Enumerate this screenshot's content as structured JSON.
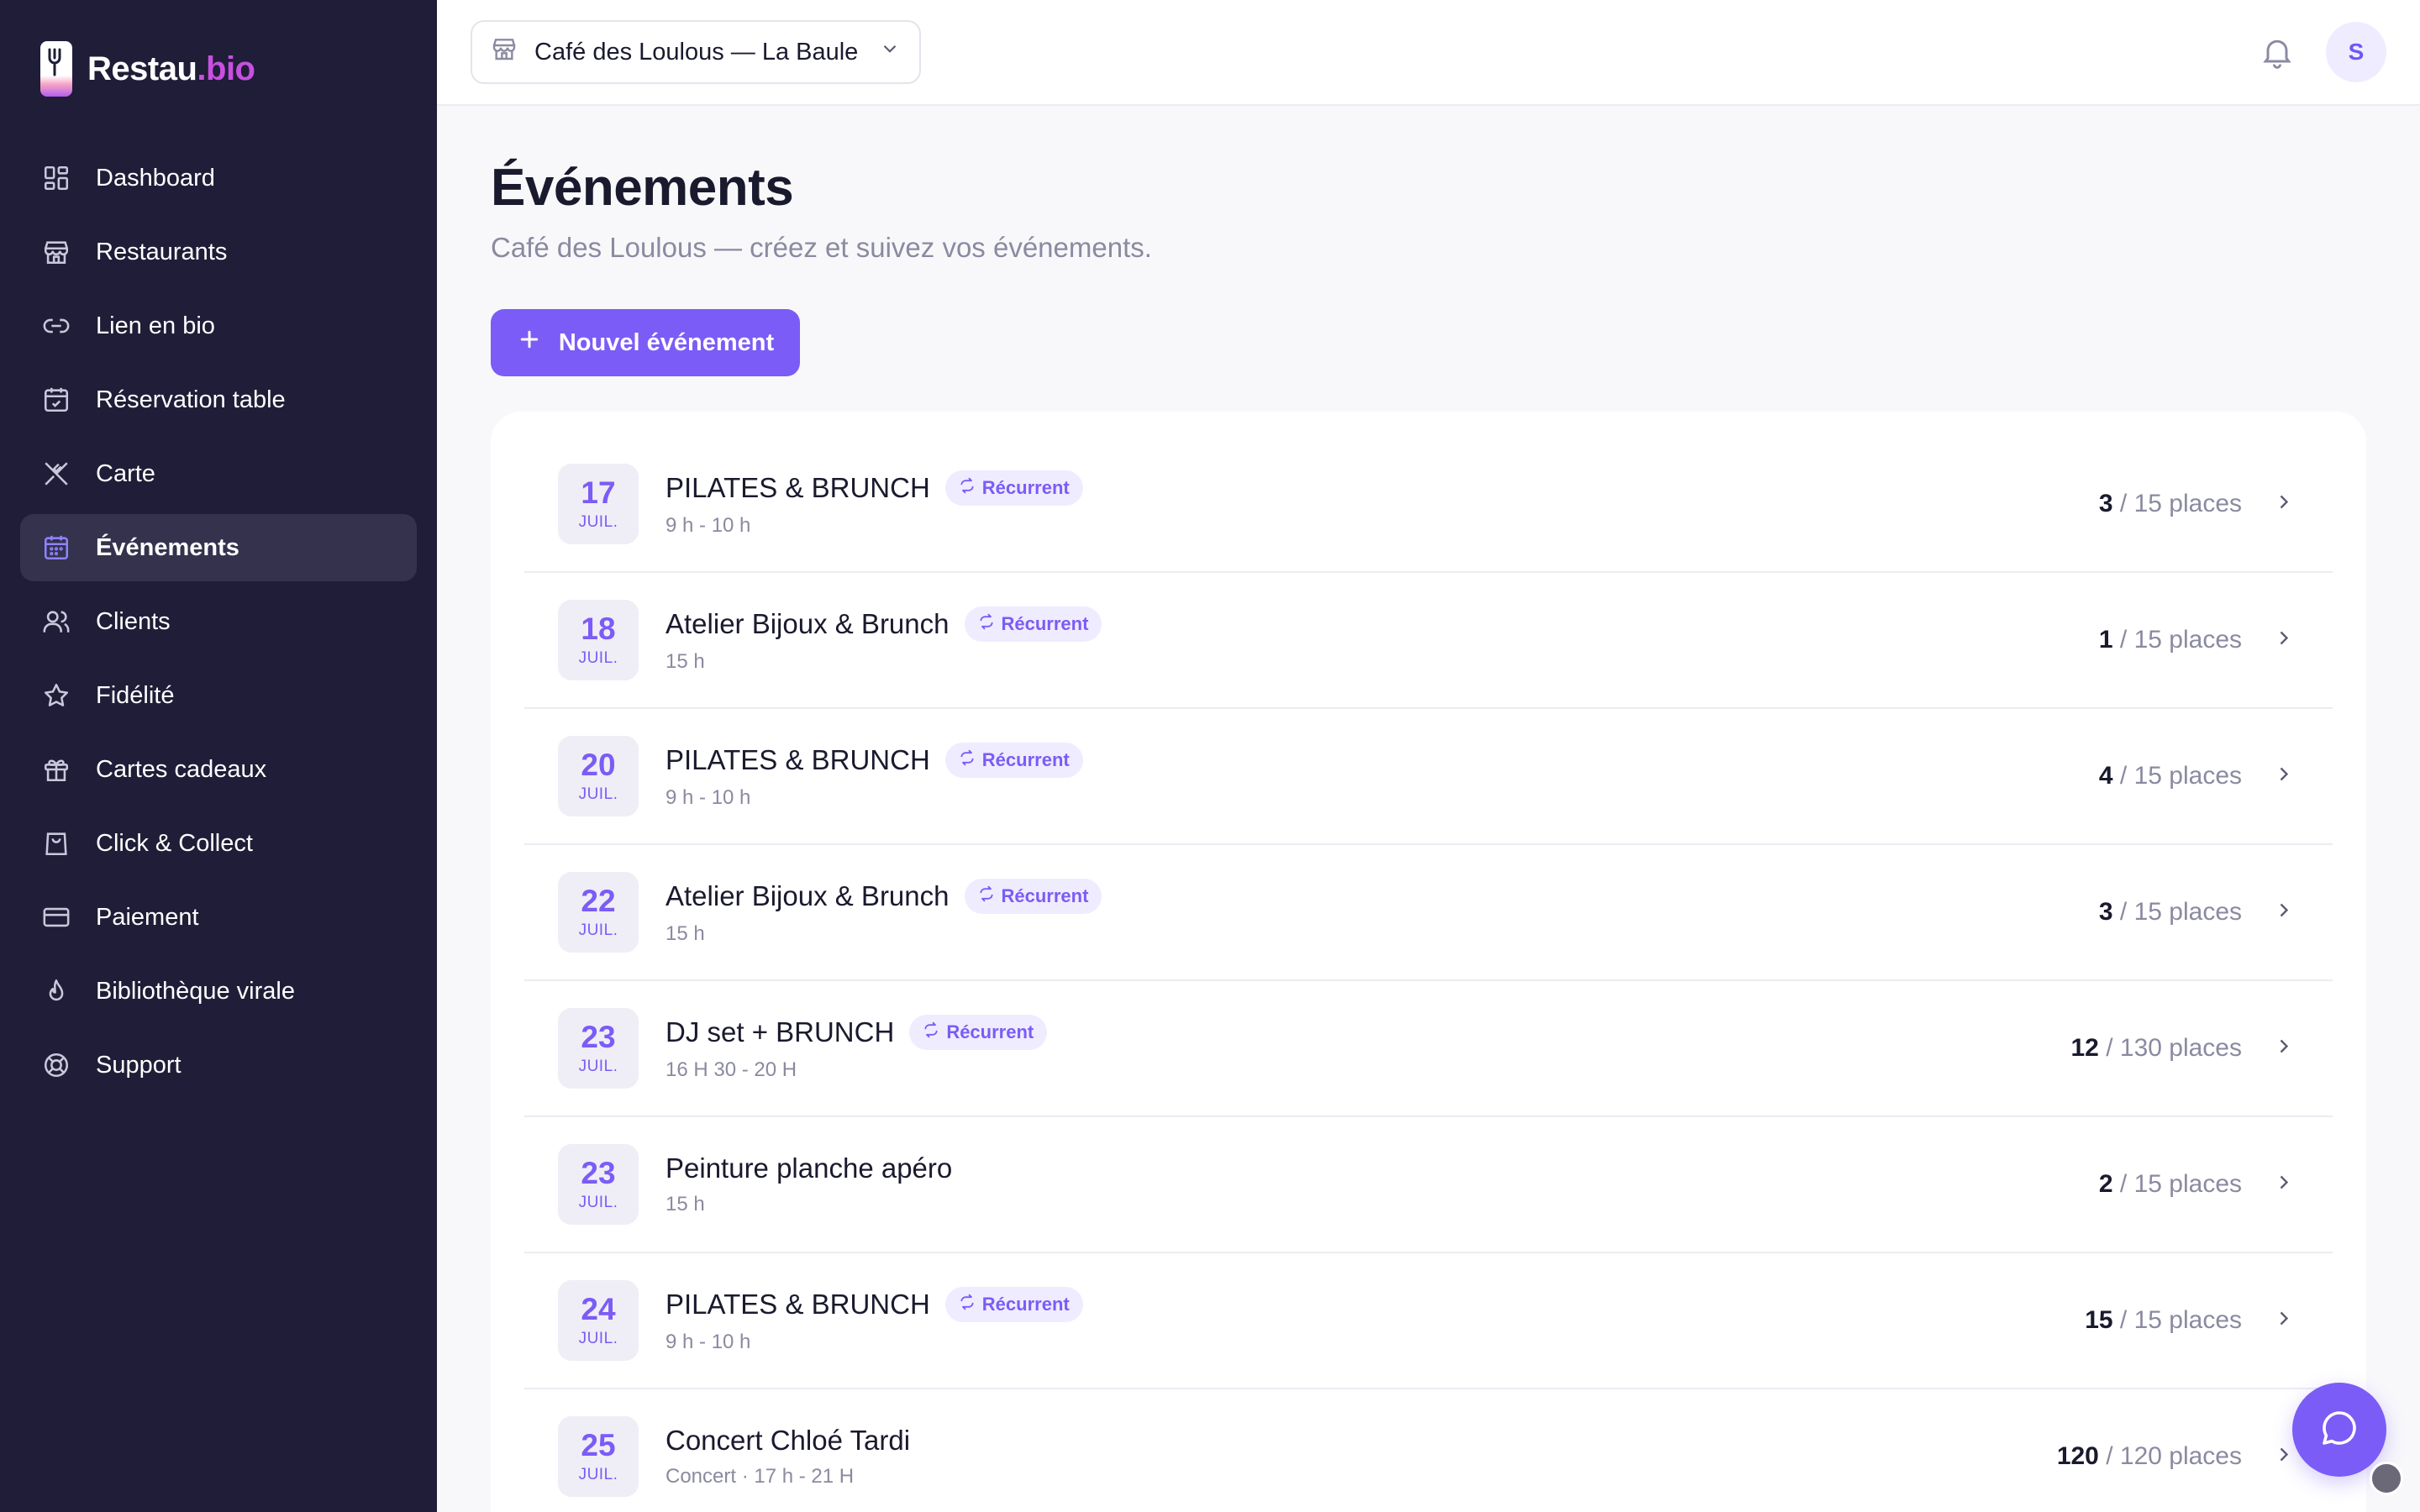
{
  "brand": {
    "name": "Restau",
    "accent": ".bio",
    "accent_color": "#c84fe0"
  },
  "sidebar": {
    "items": [
      {
        "label": "Dashboard",
        "icon": "dashboard-icon"
      },
      {
        "label": "Restaurants",
        "icon": "store-icon"
      },
      {
        "label": "Lien en bio",
        "icon": "link-icon"
      },
      {
        "label": "Réservation table",
        "icon": "calendar-check-icon"
      },
      {
        "label": "Carte",
        "icon": "utensils-icon"
      },
      {
        "label": "Événements",
        "icon": "calendar-icon",
        "active": true
      },
      {
        "label": "Clients",
        "icon": "users-icon"
      },
      {
        "label": "Fidélité",
        "icon": "star-icon"
      },
      {
        "label": "Cartes cadeaux",
        "icon": "gift-icon"
      },
      {
        "label": "Click & Collect",
        "icon": "shopping-bag-icon"
      },
      {
        "label": "Paiement",
        "icon": "credit-card-icon"
      },
      {
        "label": "Bibliothèque virale",
        "icon": "flame-icon"
      },
      {
        "label": "Support",
        "icon": "lifebuoy-icon"
      }
    ]
  },
  "topbar": {
    "venue": "Café des Loulous — La Baule",
    "avatar_initial": "S"
  },
  "main": {
    "title": "Événements",
    "subtitle": "Café des Loulous — créez et suivez vos événements.",
    "new_button": "Nouvel événement"
  },
  "recurrent_label": "Récurrent",
  "events": [
    {
      "day": "17",
      "month": "JUIL.",
      "title": "PILATES & BRUNCH",
      "recurrent": true,
      "time": "9 h - 10 h",
      "booked": "3",
      "capacity": "/ 15 places"
    },
    {
      "day": "18",
      "month": "JUIL.",
      "title": "Atelier Bijoux & Brunch",
      "recurrent": true,
      "time": "15 h",
      "booked": "1",
      "capacity": "/ 15 places"
    },
    {
      "day": "20",
      "month": "JUIL.",
      "title": "PILATES & BRUNCH",
      "recurrent": true,
      "time": "9 h - 10 h",
      "booked": "4",
      "capacity": "/ 15 places"
    },
    {
      "day": "22",
      "month": "JUIL.",
      "title": "Atelier Bijoux & Brunch",
      "recurrent": true,
      "time": "15 h",
      "booked": "3",
      "capacity": "/ 15 places"
    },
    {
      "day": "23",
      "month": "JUIL.",
      "title": "DJ set + BRUNCH",
      "recurrent": true,
      "time": "16 H 30 - 20 H",
      "booked": "12",
      "capacity": "/ 130 places"
    },
    {
      "day": "23",
      "month": "JUIL.",
      "title": "Peinture planche apéro",
      "recurrent": false,
      "time": "15 h",
      "booked": "2",
      "capacity": "/ 15 places"
    },
    {
      "day": "24",
      "month": "JUIL.",
      "title": "PILATES & BRUNCH",
      "recurrent": true,
      "time": "9 h - 10 h",
      "booked": "15",
      "capacity": "/ 15 places"
    },
    {
      "day": "25",
      "month": "JUIL.",
      "title": "Concert Chloé Tardi",
      "recurrent": false,
      "time": "Concert · 17 h - 21 H",
      "booked": "120",
      "capacity": "/ 120 places"
    }
  ],
  "colors": {
    "sidebar_bg": "#1f1d37",
    "primary": "#7b5cf6",
    "badge_bg": "#efecff"
  }
}
